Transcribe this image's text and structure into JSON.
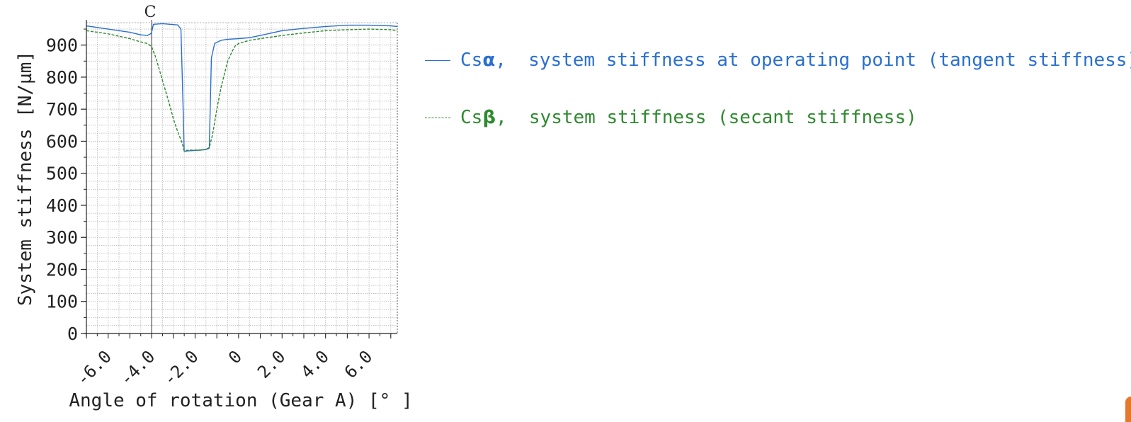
{
  "chart_data": {
    "type": "line",
    "xlabel": "Angle of rotation (Gear A) [° ]",
    "ylabel": "System stiffness [N/µm]",
    "xlim": [
      -7.0,
      7.3
    ],
    "ylim": [
      0,
      970
    ],
    "x_ticks": [
      "-6.0",
      "-4.0",
      "-2.0",
      "0",
      "2.0",
      "4.0",
      "6.0"
    ],
    "x_tick_values": [
      -6,
      -4,
      -2,
      0,
      2,
      4,
      6
    ],
    "y_ticks": [
      0,
      100,
      200,
      300,
      400,
      500,
      600,
      700,
      800,
      900
    ],
    "grid": true,
    "legend_position": "right of plot",
    "annotation": {
      "label": "C",
      "x": -4.0
    },
    "series": [
      {
        "name": "Csα, system stiffness at operating point (tangent stiffness)",
        "color": "#2a6fd0",
        "style": "solid",
        "x": [
          -7.0,
          -6.0,
          -5.0,
          -4.5,
          -4.2,
          -4.05,
          -4.0,
          -3.92,
          -3.5,
          -2.8,
          -2.65,
          -2.55,
          -2.5,
          -2.3,
          -1.8,
          -1.5,
          -1.35,
          -1.25,
          -1.1,
          -0.8,
          -0.5,
          0.0,
          0.5,
          1.0,
          2.0,
          3.0,
          4.0,
          5.0,
          6.0,
          7.0,
          7.3
        ],
        "y": [
          960,
          950,
          940,
          932,
          930,
          935,
          940,
          965,
          967,
          963,
          950,
          700,
          568,
          570,
          572,
          574,
          578,
          860,
          905,
          915,
          918,
          920,
          923,
          930,
          945,
          952,
          958,
          962,
          962,
          960,
          958
        ]
      },
      {
        "name": "Csβ, system stiffness (secant stiffness)",
        "color": "#2f8a2f",
        "style": "dashed",
        "x": [
          -7.0,
          -6.0,
          -5.0,
          -4.5,
          -4.2,
          -4.0,
          -3.8,
          -3.5,
          -3.2,
          -3.0,
          -2.8,
          -2.6,
          -2.5,
          -2.3,
          -2.0,
          -1.7,
          -1.5,
          -1.35,
          -1.2,
          -1.0,
          -0.8,
          -0.5,
          -0.3,
          -0.15,
          0.0,
          0.5,
          1.0,
          2.0,
          3.0,
          4.0,
          5.0,
          6.0,
          7.0,
          7.3
        ],
        "y": [
          945,
          935,
          920,
          910,
          905,
          895,
          860,
          790,
          720,
          670,
          630,
          595,
          570,
          572,
          572,
          572,
          575,
          580,
          620,
          700,
          770,
          850,
          880,
          898,
          905,
          915,
          920,
          930,
          938,
          945,
          948,
          950,
          948,
          945
        ]
      }
    ]
  },
  "legend": {
    "items": [
      {
        "prefix": "Cs",
        "symbol": "α",
        "rest": ",  system stiffness at operating point (tangent stiffness)"
      },
      {
        "prefix": "Cs",
        "symbol": "β",
        "rest": ",  system stiffness (secant stiffness)"
      }
    ]
  }
}
